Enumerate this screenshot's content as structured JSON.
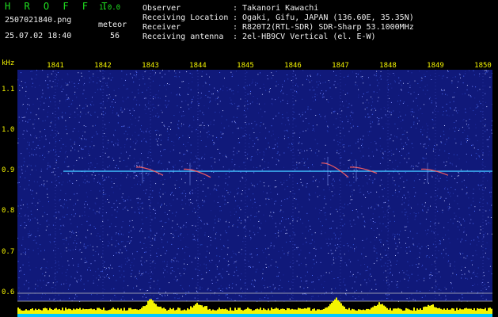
{
  "header": {
    "app_name": "H R O F F T",
    "version": "1.0.0",
    "filename": "2507021840.png",
    "datetime": "25.07.02 18:40",
    "meteor_label": "meteor",
    "meteor_count": "56"
  },
  "metadata": [
    {
      "key": "Observer",
      "value": "Takanori Kawachi"
    },
    {
      "key": "Receiving Location",
      "value": "Ogaki, Gifu, JAPAN (136.60E, 35.35N)"
    },
    {
      "key": "Receiver",
      "value": "R820T2(RTL-SDR) SDR-Sharp 53.1000MHz"
    },
    {
      "key": "Receiving antenna",
      "value": "2el-HB9CV Vertical (el. E-W)"
    }
  ],
  "axis": {
    "unit": "kHz",
    "x_ticks": [
      "1841",
      "1842",
      "1843",
      "1844",
      "1845",
      "1846",
      "1847",
      "1848",
      "1849",
      "1850"
    ],
    "y_ticks": [
      "1.1",
      "1.0",
      "0.9",
      "0.8",
      "0.7",
      "0.6"
    ]
  },
  "colors": {
    "background": "#10197a",
    "carrier": "#40c0ff",
    "meteor": "#ff6060",
    "level": "#f4f400",
    "baseline": "#00c8ff"
  },
  "chart_data": {
    "type": "heatmap",
    "x_ticks": [
      "1841",
      "1842",
      "1843",
      "1844",
      "1845",
      "1846",
      "1847",
      "1848",
      "1849",
      "1850"
    ],
    "y_ticks": [
      1.1,
      1.0,
      0.9,
      0.8,
      0.7,
      0.6
    ],
    "ylabel": "kHz",
    "ylim": [
      0.58,
      1.15
    ],
    "carrier_khz": 0.9,
    "meteor_echoes": [
      {
        "time": 1842.9,
        "khz_start": 0.91,
        "khz_end": 0.89
      },
      {
        "time": 1843.9,
        "khz_start": 0.905,
        "khz_end": 0.885
      },
      {
        "time": 1846.8,
        "khz_start": 0.92,
        "khz_end": 0.885
      },
      {
        "time": 1847.4,
        "khz_start": 0.91,
        "khz_end": 0.895
      },
      {
        "time": 1848.9,
        "khz_start": 0.905,
        "khz_end": 0.89
      }
    ],
    "level_peaks": [
      {
        "time": 1843.0,
        "level": 0.9
      },
      {
        "time": 1844.0,
        "level": 0.5
      },
      {
        "time": 1846.9,
        "level": 1.0
      },
      {
        "time": 1847.8,
        "level": 0.5
      },
      {
        "time": 1848.9,
        "level": 0.4
      }
    ]
  }
}
